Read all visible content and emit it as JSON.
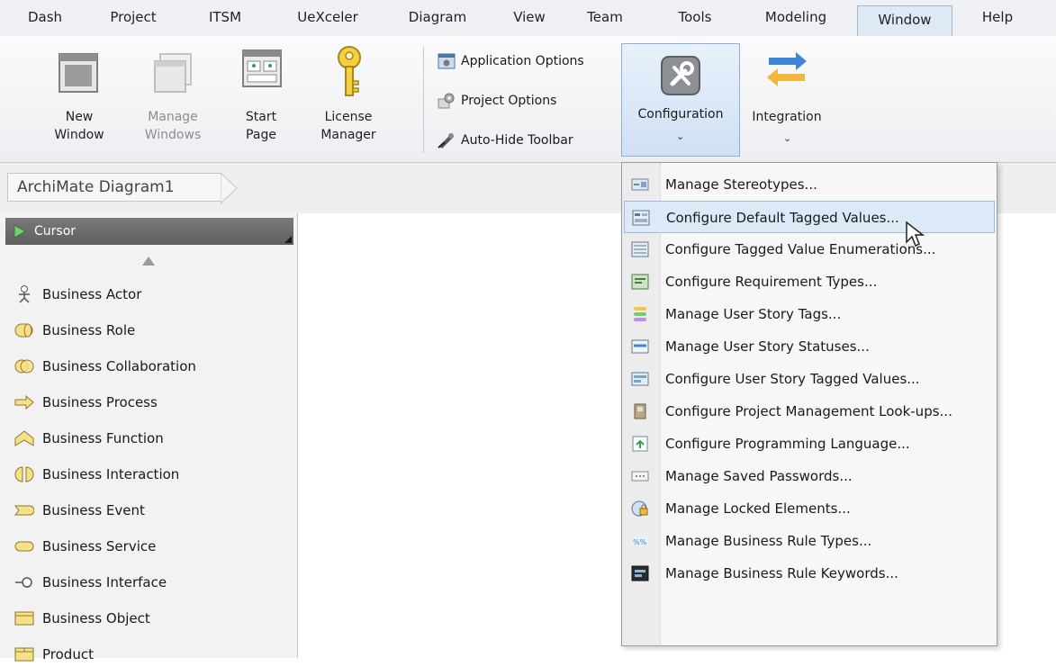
{
  "menubar": {
    "items": [
      "Dash",
      "Project",
      "ITSM",
      "UeXceler",
      "Diagram",
      "View",
      "Team",
      "Tools",
      "Modeling",
      "Window",
      "Help"
    ],
    "active": "Window"
  },
  "ribbon": {
    "new_window": [
      "New",
      "Window"
    ],
    "manage_windows": [
      "Manage",
      "Windows"
    ],
    "start_page": [
      "Start",
      "Page"
    ],
    "license_manager": [
      "License",
      "Manager"
    ],
    "application_options": "Application Options",
    "project_options": "Project Options",
    "auto_hide_toolbar": "Auto-Hide Toolbar",
    "configuration": "Configuration",
    "integration": "Integration"
  },
  "breadcrumb": {
    "label": "ArchiMate Diagram1"
  },
  "palette": {
    "cursor": "Cursor",
    "items": [
      {
        "label": "Business Actor",
        "icon": "actor-icon"
      },
      {
        "label": "Business Role",
        "icon": "role-icon"
      },
      {
        "label": "Business Collaboration",
        "icon": "collaboration-icon"
      },
      {
        "label": "Business Process",
        "icon": "process-icon"
      },
      {
        "label": "Business Function",
        "icon": "function-icon"
      },
      {
        "label": "Business Interaction",
        "icon": "interaction-icon"
      },
      {
        "label": "Business Event",
        "icon": "event-icon"
      },
      {
        "label": "Business Service",
        "icon": "service-icon"
      },
      {
        "label": "Business Interface",
        "icon": "interface-icon"
      },
      {
        "label": "Business Object",
        "icon": "object-icon"
      },
      {
        "label": "Product",
        "icon": "product-icon"
      }
    ]
  },
  "configuration_menu": {
    "items": [
      "Manage Stereotypes...",
      "Configure Default Tagged Values...",
      "Configure Tagged Value Enumerations...",
      "Configure Requirement Types...",
      "Manage User Story Tags...",
      "Manage User Story Statuses...",
      "Configure User Story Tagged Values...",
      "Configure Project Management Look-ups...",
      "Configure Programming Language...",
      "Manage Saved Passwords...",
      "Manage Locked Elements...",
      "Manage Business Rule Types...",
      "Manage Business Rule Keywords..."
    ],
    "highlighted": "Configure Default Tagged Values..."
  },
  "colors": {
    "accent": "#dce9f7",
    "accent_border": "#9dbbe0",
    "palette_cursor": "#6a6a6a",
    "business_yellow": "#f7e08a"
  }
}
